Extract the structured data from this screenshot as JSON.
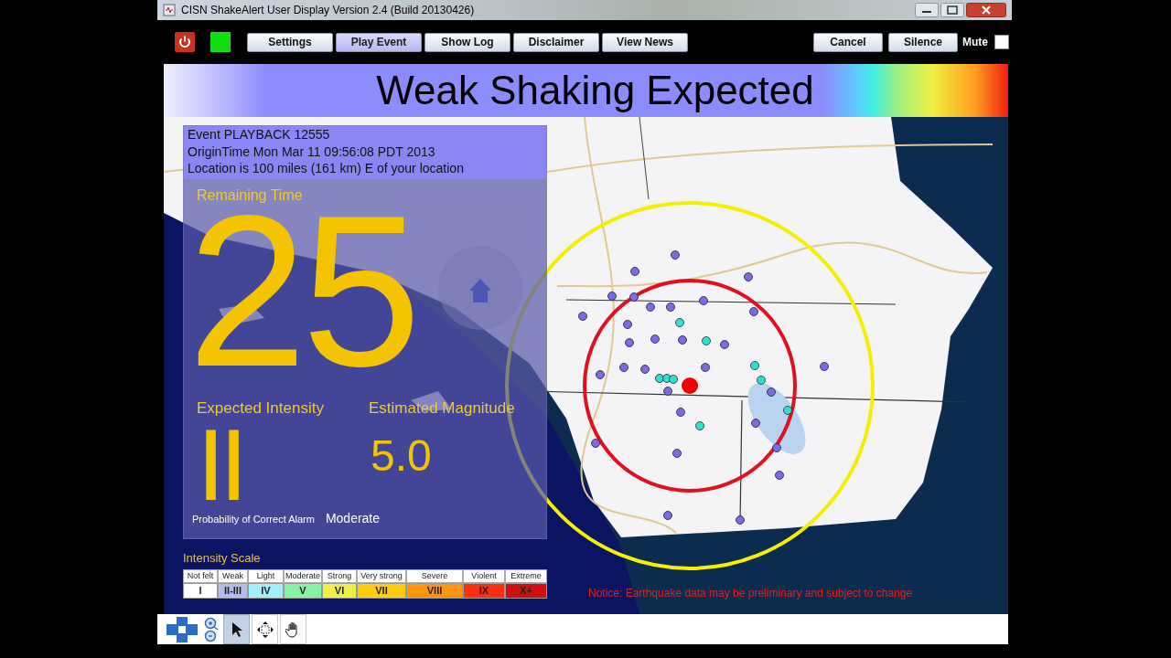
{
  "window": {
    "title": "CISN ShakeAlert User Display Version 2.4 (Build 20130426)"
  },
  "toolbar": {
    "status_on": true,
    "buttons": [
      {
        "label": "Settings",
        "selected": false
      },
      {
        "label": "Play Event",
        "selected": true
      },
      {
        "label": "Show Log",
        "selected": false
      },
      {
        "label": "Disclaimer",
        "selected": false
      },
      {
        "label": "View News",
        "selected": false
      }
    ],
    "right_buttons": [
      "Cancel",
      "Silence"
    ],
    "mute": {
      "label": "Mute",
      "checked": false
    }
  },
  "header": {
    "title": "Weak Shaking Expected"
  },
  "event": {
    "lines": [
      "Event PLAYBACK 12555",
      "OriginTime Mon Mar 11 09:56:08 PDT 2013",
      "Location is 100 miles (161 km) E of your location"
    ],
    "remaining_label": "Remaining Time",
    "remaining": "25",
    "intensity_label": "Expected Intensity",
    "intensity": "II",
    "magnitude_label": "Estimated Magnitude",
    "magnitude": "5.0",
    "probability_label": "Probability of Correct Alarm",
    "probability": "Moderate"
  },
  "intensity_scale": {
    "title": "Intensity Scale",
    "levels": [
      {
        "label": "Not felt",
        "numeral": "I",
        "color": "#ffffff"
      },
      {
        "label": "Weak",
        "numeral": "II-III",
        "color": "#b4bcee"
      },
      {
        "label": "Light",
        "numeral": "IV",
        "color": "#a0f0f4"
      },
      {
        "label": "Moderate",
        "numeral": "V",
        "color": "#84f4a4"
      },
      {
        "label": "Strong",
        "numeral": "VI",
        "color": "#eef048"
      },
      {
        "label": "Very strong",
        "numeral": "VII",
        "color": "#ffcc10"
      },
      {
        "label": "Severe",
        "numeral": "VIII",
        "color": "#ff9410"
      },
      {
        "label": "Violent",
        "numeral": "IX",
        "color": "#f83010"
      },
      {
        "label": "Extreme",
        "numeral": "X+",
        "color": "#d01010"
      }
    ]
  },
  "notice": "Notice: Earthquake data may be preliminary and subject to change",
  "tools": [
    {
      "kind": "navigate",
      "selected": false
    },
    {
      "kind": "zoom",
      "selected": false
    },
    {
      "kind": "pointer",
      "selected": true
    },
    {
      "kind": "move",
      "selected": false
    },
    {
      "kind": "pan",
      "selected": false
    }
  ]
}
